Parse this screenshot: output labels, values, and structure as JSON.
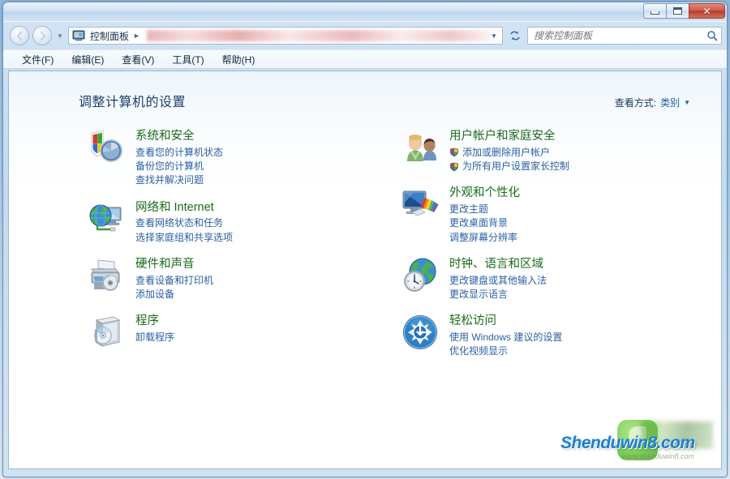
{
  "window": {
    "title": "",
    "buttons": {
      "minimize": "minimize",
      "maximize": "maximize",
      "close": "✕"
    }
  },
  "navigation": {
    "back_icon": "◄",
    "forward_icon": "►",
    "history_dropdown_icon": "▼",
    "refresh_icon": "↻",
    "address_dropdown_icon": "▼",
    "breadcrumb": [
      {
        "label": "控制面板",
        "separator": "►"
      }
    ],
    "breadcrumb_trailing_separator": "►",
    "computer_icon": "control-panel-icon"
  },
  "search": {
    "placeholder": "搜索控制面板",
    "value": "",
    "icon": "search-icon"
  },
  "menubar": {
    "items": [
      {
        "label": "文件(F)"
      },
      {
        "label": "编辑(E)"
      },
      {
        "label": "查看(V)"
      },
      {
        "label": "工具(T)"
      },
      {
        "label": "帮助(H)"
      }
    ]
  },
  "page": {
    "title": "调整计算机的设置",
    "view_by": {
      "label": "查看方式:",
      "value": "类别",
      "arrow": "▼"
    }
  },
  "categories": {
    "left": [
      {
        "icon": "security-shield-icon",
        "title": "系统和安全",
        "links": [
          {
            "label": "查看您的计算机状态",
            "shield": false
          },
          {
            "label": "备份您的计算机",
            "shield": false
          },
          {
            "label": "查找并解决问题",
            "shield": false
          }
        ]
      },
      {
        "icon": "network-globe-icon",
        "title": "网络和 Internet",
        "links": [
          {
            "label": "查看网络状态和任务",
            "shield": false
          },
          {
            "label": "选择家庭组和共享选项",
            "shield": false
          }
        ]
      },
      {
        "icon": "printer-hardware-icon",
        "title": "硬件和声音",
        "links": [
          {
            "label": "查看设备和打印机",
            "shield": false
          },
          {
            "label": "添加设备",
            "shield": false
          }
        ]
      },
      {
        "icon": "programs-box-icon",
        "title": "程序",
        "links": [
          {
            "label": "卸载程序",
            "shield": false
          }
        ]
      }
    ],
    "right": [
      {
        "icon": "user-accounts-icon",
        "title": "用户帐户和家庭安全",
        "links": [
          {
            "label": "添加或删除用户帐户",
            "shield": true
          },
          {
            "label": "为所有用户设置家长控制",
            "shield": true
          }
        ]
      },
      {
        "icon": "appearance-monitor-icon",
        "title": "外观和个性化",
        "links": [
          {
            "label": "更改主题",
            "shield": false
          },
          {
            "label": "更改桌面背景",
            "shield": false
          },
          {
            "label": "调整屏幕分辨率",
            "shield": false
          }
        ]
      },
      {
        "icon": "clock-globe-icon",
        "title": "时钟、语言和区域",
        "links": [
          {
            "label": "更改键盘或其他输入法",
            "shield": false
          },
          {
            "label": "更改显示语言",
            "shield": false
          }
        ]
      },
      {
        "icon": "ease-of-access-icon",
        "title": "轻松访问",
        "links": [
          {
            "label": "使用 Windows 建议的设置",
            "shield": false
          },
          {
            "label": "优化视频显示",
            "shield": false
          }
        ]
      }
    ]
  },
  "watermark": {
    "text": "Shenduwin8.com",
    "subtext": "www.shenduwin8.com",
    "logo": "leaf-logo-icon"
  },
  "colors": {
    "category_title": "#1b6a1b",
    "link": "#2b5fa3",
    "page_title": "#1b3f6b",
    "close_button": "#bb3c2a",
    "watermark": "#1b7fd4"
  }
}
